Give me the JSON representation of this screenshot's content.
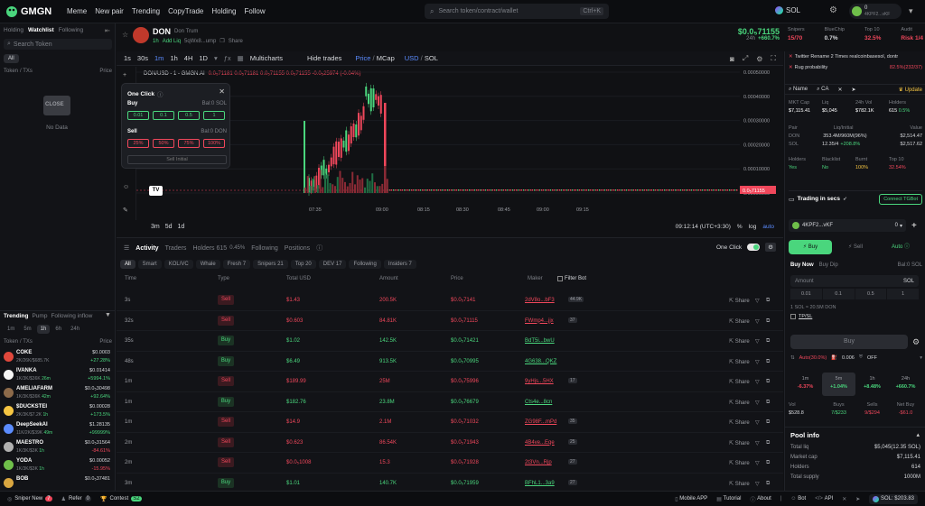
{
  "topbar": {
    "logo": "GMGN",
    "nav": [
      "Meme",
      "New pair",
      "Trending",
      "CopyTrade",
      "Holding",
      "Follow"
    ],
    "search_placeholder": "Search token/contract/wallet",
    "search_shortcut": "Ctrl+K",
    "chain": "SOL",
    "wallet_balance": "0",
    "wallet_addr": "4KPF2...vKF"
  },
  "left": {
    "tabs": [
      "Holding",
      "Watchlist",
      "Following"
    ],
    "search_placeholder": "Search Token",
    "filter_all": "All",
    "col_token": "Token",
    "col_txs": "/ TXs",
    "col_price": "Price",
    "empty_close": "CLOSE",
    "empty_text": "No Data",
    "trending_tabs": [
      "Trending",
      "Pump",
      "Following inflow"
    ],
    "time_tabs": [
      "1m",
      "5m",
      "1h",
      "6h",
      "24h"
    ],
    "active_time": "1h",
    "tokens": [
      {
        "name": "COKE",
        "sub": "2K/26K/$685.7K",
        "mc": "",
        "price": "$0.0003",
        "change": "+27.28%",
        "color": "#e0483c"
      },
      {
        "name": "IVANKA",
        "sub": "1K/3K/$36K",
        "mc": "26m",
        "price": "$0.01414",
        "change": "+5994.1%",
        "color": "#f5f5f5"
      },
      {
        "name": "AMELIAFARM",
        "sub": "1K/3K/$36K",
        "mc": "42m",
        "price": "$0.0₅30498",
        "change": "+92.64%",
        "color": "#8c6a4a"
      },
      {
        "name": "$DUCKSTEI",
        "sub": "2K/3K/$7.2K",
        "mc": "1h",
        "price": "$0.00028",
        "change": "+173.5%",
        "color": "#f5c542"
      },
      {
        "name": "DeepSeekAI",
        "sub": "11K/2K/$39K",
        "mc": "49m",
        "price": "$1.28135",
        "change": "+99999%",
        "color": "#5b8cff"
      },
      {
        "name": "MAESTRO",
        "sub": "1K/3K/$3K",
        "mc": "1h",
        "price": "$0.0₅31564",
        "change": "-84.61%",
        "color": "#b0b0b0"
      },
      {
        "name": "YODA",
        "sub": "1K/3K/$3K",
        "mc": "1h",
        "price": "$0.00052",
        "change": "-15.95%",
        "color": "#6fbf4a"
      },
      {
        "name": "BOB",
        "sub": "",
        "mc": "",
        "price": "$0.0₅37481",
        "change": "",
        "color": "#d9a640"
      }
    ]
  },
  "token": {
    "symbol": "DON",
    "name": "Don Trum",
    "age": "1h",
    "add_liq": "Add Liq",
    "address": "5qWx8...ump",
    "share": "Share",
    "price": "$0.0₅71155",
    "change_24h_label": "24h",
    "change_24h": "+660.7%"
  },
  "stats_top": [
    {
      "label": "Snipers",
      "value": "15/70",
      "color": "#f0475b",
      "icon": "sniper-icon"
    },
    {
      "label": "BlueChip",
      "value": "0.7%",
      "color": "#d6d8dc",
      "icon": "bluechip-icon"
    },
    {
      "label": "Top 10",
      "value": "32.5%",
      "color": "#f0475b",
      "icon": ""
    },
    {
      "label": "Audit",
      "value": "Risk 1/4",
      "color": "#f0475b",
      "icon": "risk-icon"
    }
  ],
  "chart": {
    "timeframes": [
      "1s",
      "30s",
      "1m",
      "1h",
      "4H",
      "1D"
    ],
    "active_tf": "1m",
    "multicharts": "Multicharts",
    "hide_trades": "Hide trades",
    "price_label": "Price",
    "mcap_label": "MCap",
    "usd_label": "USD",
    "sol_label": "SOL",
    "ohlc_title": "DON/USD - 1 - GMGN.AI",
    "ohlc": "0.0₅71181 0.0₅71181 0.0₅71155 0.0₅71155 -0.0₅25974 (-0.04%)",
    "y_ticks": [
      "0.00050000",
      "0.00040000",
      "0.00030000",
      "0.00020000",
      "0.00010000",
      "0.00000000"
    ],
    "x_ticks": [
      "07:35",
      "09:00",
      "08:15",
      "08:30",
      "08:45",
      "09:00",
      "09:15"
    ],
    "last_price": "0.0₅71155",
    "time": "09:12:14 (UTC+3:30)",
    "range_tabs": [
      "3m",
      "5d",
      "1d"
    ],
    "pct": "%",
    "log": "log",
    "auto": "auto"
  },
  "oneclick": {
    "title": "One Click",
    "buy": "Buy",
    "buy_bal": "Bal:0 SOL",
    "buy_amounts": [
      "0.01",
      "0.1",
      "0.5",
      "1"
    ],
    "sell": "Sell",
    "sell_bal": "Bal:0 DON",
    "sell_amounts": [
      "25%",
      "50%",
      "75%",
      "100%"
    ],
    "sell_init": "Sell Initial"
  },
  "activity": {
    "tabs": [
      "Activity",
      "Traders",
      "Holders 615",
      "Following",
      "Positions"
    ],
    "holders_pct": "0.45%",
    "oneclick": "One Click",
    "filters": [
      "All",
      "Smart",
      "KOL/VC",
      "Whale",
      "Fresh 7",
      "Snipers 21",
      "Top 20",
      "DEV 17",
      "Following",
      "Insiders 7"
    ],
    "cols": [
      "Time",
      "Type",
      "Total USD",
      "Amount",
      "Price",
      "Maker",
      "Filter Bot"
    ],
    "share": "Share",
    "rows": [
      {
        "time": "3s",
        "type": "Sell",
        "usd": "$1.43",
        "amount": "200.5K",
        "price": "$0.0₅7141",
        "maker": "2dV8o...bF3",
        "tag": "44.9K"
      },
      {
        "time": "32s",
        "type": "Sell",
        "usd": "$0.603",
        "amount": "84.81K",
        "price": "$0.0₅71115",
        "maker": "FWmp4...jjx",
        "tag": "37"
      },
      {
        "time": "35s",
        "type": "Buy",
        "usd": "$1.02",
        "amount": "142.5K",
        "price": "$0.0₅71421",
        "maker": "BdT5i...bwU",
        "tag": ""
      },
      {
        "time": "48s",
        "type": "Buy",
        "usd": "$6.49",
        "amount": "913.5K",
        "price": "$0.0₅70995",
        "maker": "4G638...QKZ",
        "tag": ""
      },
      {
        "time": "1m",
        "type": "Sell",
        "usd": "$189.99",
        "amount": "25M",
        "price": "$0.0₅75996",
        "maker": "9yHjs...5HX",
        "tag": "17"
      },
      {
        "time": "1m",
        "type": "Buy",
        "usd": "$182.76",
        "amount": "23.8M",
        "price": "$0.0₅76679",
        "maker": "Cts4e...8cn",
        "tag": ""
      },
      {
        "time": "1m",
        "type": "Sell",
        "usd": "$14.9",
        "amount": "2.1M",
        "price": "$0.0₅71032",
        "maker": "ZG98F...mPd",
        "tag": "35"
      },
      {
        "time": "2m",
        "type": "Sell",
        "usd": "$0.623",
        "amount": "86.54K",
        "price": "$0.0₅71943",
        "maker": "4B4ve...Eqe",
        "tag": "25"
      },
      {
        "time": "2m",
        "type": "Sell",
        "usd": "$0.0₅1008",
        "amount": "15.3",
        "price": "$0.0₅71928",
        "maker": "2t3Vn...Rjp",
        "tag": "27"
      },
      {
        "time": "3m",
        "type": "Buy",
        "usd": "$1.01",
        "amount": "140.7K",
        "price": "$0.0₅71959",
        "maker": "BFhL1...3a9",
        "tag": "27"
      }
    ]
  },
  "right": {
    "alerts": [
      {
        "text": "Twitter Rename 2 Times realcoinbasesol, dontr",
        "value": ""
      },
      {
        "text": "Rug probability",
        "value": "82.5%(232/37)"
      }
    ],
    "info_tabs": [
      "Name",
      "CA",
      "",
      "",
      "Update"
    ],
    "grid1_labels": [
      "MKT Cap",
      "Liq",
      "24h Vol",
      "Holders"
    ],
    "grid1_values": [
      "$7,115.41",
      "$5,045",
      "$782.1K",
      "615"
    ],
    "holders_pct": "0.5%",
    "pair_label": "Pair",
    "pair_cols": [
      "Liq/Initial",
      "Value"
    ],
    "pair_rows": [
      {
        "name": "DON",
        "liq": "353.4M/960M(96%)",
        "value": "$2,514.47"
      },
      {
        "name": "SOL",
        "liq": "12.35/4",
        "liq_change": "+208.8%",
        "value": "$2,517.62"
      }
    ],
    "audit_labels": [
      "Holders",
      "Blacklist",
      "Burnt",
      "Top 10"
    ],
    "audit_values": [
      "Yes",
      "No",
      "100%",
      "32.54%"
    ],
    "trading_secs": "Trading in secs",
    "connect_tg": "Connect TGBot",
    "wallet": "4KPF2...vKF",
    "wallet_bal": "0",
    "trade_tabs": [
      "Buy",
      "Sell",
      "Auto"
    ],
    "buy_now": "Buy Now",
    "buy_dip": "Buy Dip",
    "bal": "Bal:0 SOL",
    "amount_label": "Amount",
    "amount_unit": "SOL",
    "amounts": [
      "0.01",
      "0.1",
      "0.5",
      "1"
    ],
    "conversion": "1 SOL ≈ 20.5M DON",
    "tpsl": "TP/SL",
    "buy_btn": "Buy",
    "auto_pct": "Auto(30.0%)",
    "gas": "0.006",
    "mev": "OFF",
    "periods": [
      "1m",
      "5m",
      "1h",
      "24h"
    ],
    "period_changes": [
      "-6.37%",
      "+1.04%",
      "+8.48%",
      "+660.7%"
    ],
    "period_colors": [
      "#f0475b",
      "#4ad67d",
      "#4ad67d",
      "#4ad67d"
    ],
    "vol_labels": [
      "Vol",
      "Buys",
      "Sells",
      "Net Buy"
    ],
    "vol_values": [
      "$528.8",
      "7/$233",
      "9/$294",
      "-$61.0"
    ],
    "pool_title": "Pool info",
    "pool": [
      {
        "label": "Total liq",
        "value": "$5,045(12.35 SOL)"
      },
      {
        "label": "Market cap",
        "value": "$7,115.41"
      },
      {
        "label": "Holders",
        "value": "614"
      },
      {
        "label": "Total supply",
        "value": "1000M"
      }
    ]
  },
  "footer": {
    "sniper": "Sniper New",
    "sniper_count": "7",
    "refer": "Refer",
    "refer_count": "0",
    "contest": "Contest",
    "contest_tag": "S2",
    "links": [
      "Mobile APP",
      "Tutorial",
      "About",
      "Bot",
      "API"
    ],
    "sol_price": "SOL: $203.83"
  }
}
